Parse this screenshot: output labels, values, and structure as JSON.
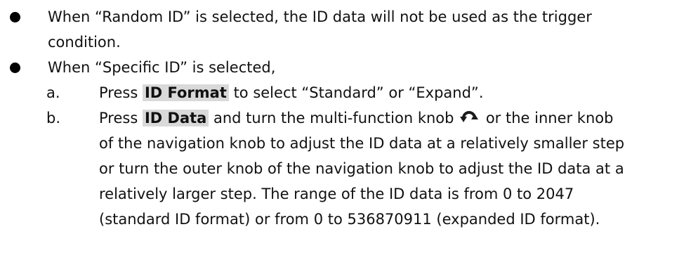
{
  "bullets": [
    {
      "lines": [
        "When “Random ID” is selected, the ID data will not be used as the trigger",
        "condition."
      ]
    },
    {
      "lines": [
        "When “Specific ID” is selected,"
      ]
    }
  ],
  "sub_items": [
    {
      "marker": "a.",
      "prefix": "Press ",
      "key": "ID Format",
      "suffix": " to select “Standard” or “Expand”."
    },
    {
      "marker": "b.",
      "prefix": "Press ",
      "key": "ID Data",
      "line1_mid": " and turn the multi-function knob ",
      "line1_end": " or the inner knob",
      "icon": "multi-function-knob-icon",
      "lines": [
        "of the navigation knob to adjust the ID data at a relatively smaller step",
        "or turn the outer knob of the navigation knob to adjust the ID data at a",
        "relatively larger step. The range of the ID data is from 0 to 2047",
        "(standard ID format) or from 0 to 536870911 (expanded ID format)."
      ]
    }
  ]
}
